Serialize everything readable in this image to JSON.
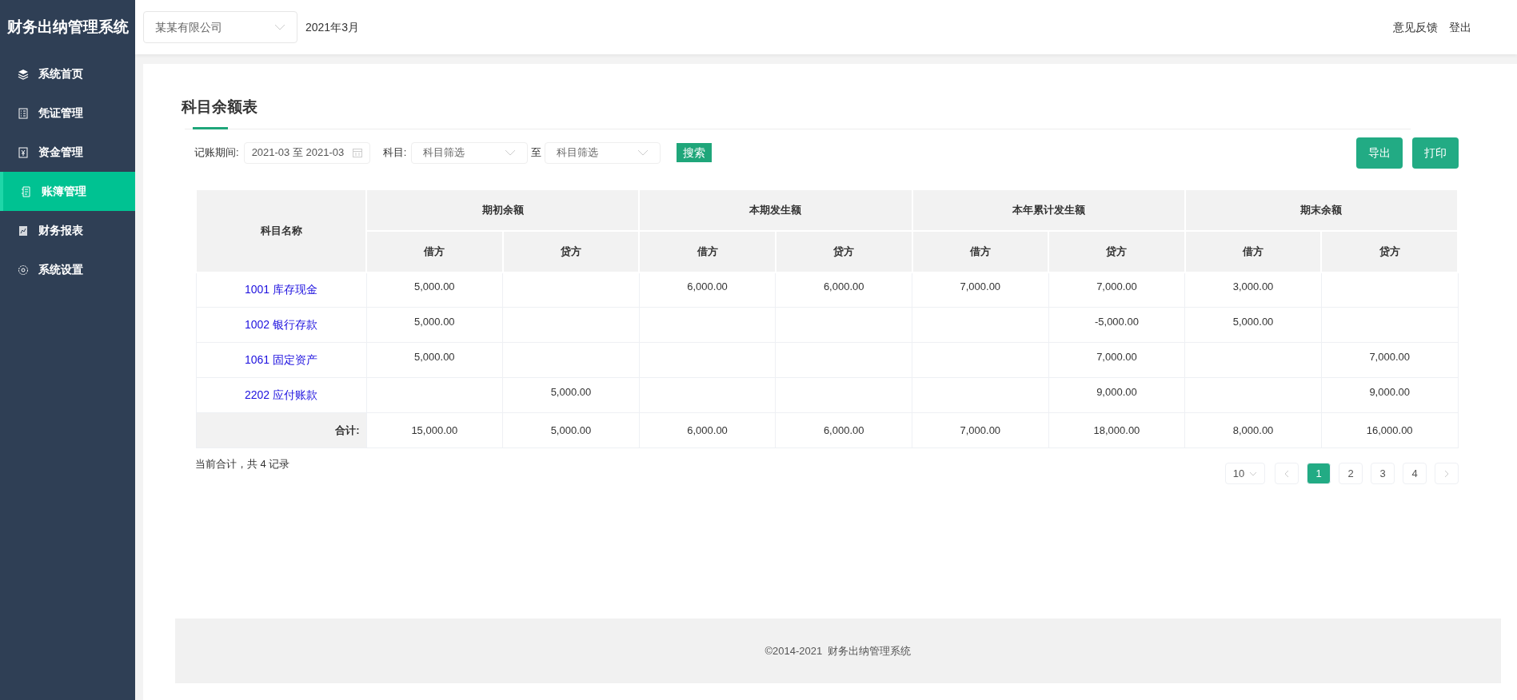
{
  "sidebar": {
    "title": "财务出纳管理系统",
    "items": [
      {
        "label": "系统首页",
        "selected": false
      },
      {
        "label": "凭证管理",
        "selected": false
      },
      {
        "label": "资金管理",
        "selected": false
      },
      {
        "label": "账簿管理",
        "selected": true
      },
      {
        "label": "财务报表",
        "selected": false
      },
      {
        "label": "系统设置",
        "selected": false
      }
    ]
  },
  "header": {
    "company_select": "某某有限公司",
    "period": "2021年3月",
    "links": [
      "意见反馈",
      "登出"
    ]
  },
  "page": {
    "title": "科目余额表",
    "filters": {
      "period_label": "记账期间:",
      "period_value": "2021-03 至 2021-03",
      "subject_label": "科目:",
      "subject_from_placeholder": "科目筛选",
      "to_label": "至",
      "subject_to_placeholder": "科目筛选",
      "search_button": "搜索"
    },
    "actions": [
      "导出",
      "打印"
    ],
    "table": {
      "name_column": "科目名称",
      "groups": [
        {
          "label": "期初余额",
          "debit": "借方",
          "credit": "贷方"
        },
        {
          "label": "本期发生额",
          "debit": "借方",
          "credit": "贷方"
        },
        {
          "label": "本年累计发生额",
          "debit": "借方",
          "credit": "贷方"
        },
        {
          "label": "期末余额",
          "debit": "借方",
          "credit": "贷方"
        }
      ],
      "rows": [
        {
          "name": "1001 库存现金",
          "opening_debit": "5,000.00",
          "period_debit": "6,000.00",
          "period_credit": "6,000.00",
          "ytd_debit": "7,000.00",
          "ytd_credit": "7,000.00",
          "closing_debit": "3,000.00"
        },
        {
          "name": "1002 银行存款",
          "opening_debit": "5,000.00",
          "ytd_credit": "-5,000.00",
          "closing_debit": "5,000.00"
        },
        {
          "name": "1061 固定资产",
          "opening_debit": "5,000.00",
          "ytd_credit": "7,000.00",
          "closing_credit": "7,000.00"
        },
        {
          "name": "2202 应付账款",
          "opening_credit": "5,000.00",
          "ytd_credit": "9,000.00",
          "closing_credit": "9,000.00"
        }
      ],
      "total": {
        "label": "合计:",
        "opening_debit": "15,000.00",
        "opening_credit": "5,000.00",
        "period_debit": "6,000.00",
        "period_credit": "6,000.00",
        "ytd_debit": "7,000.00",
        "ytd_credit": "18,000.00",
        "closing_debit": "8,000.00",
        "closing_credit": "16,000.00"
      }
    },
    "summary": "当前合计，共 4 记录",
    "pagination": {
      "page_size": "10",
      "pages": [
        {
          "label": "1",
          "selected": true
        },
        {
          "label": "2",
          "selected": false
        },
        {
          "label": "3",
          "selected": false
        },
        {
          "label": "4",
          "selected": false
        }
      ]
    }
  },
  "footer": "©2014-2021  财务出纳管理系统"
}
